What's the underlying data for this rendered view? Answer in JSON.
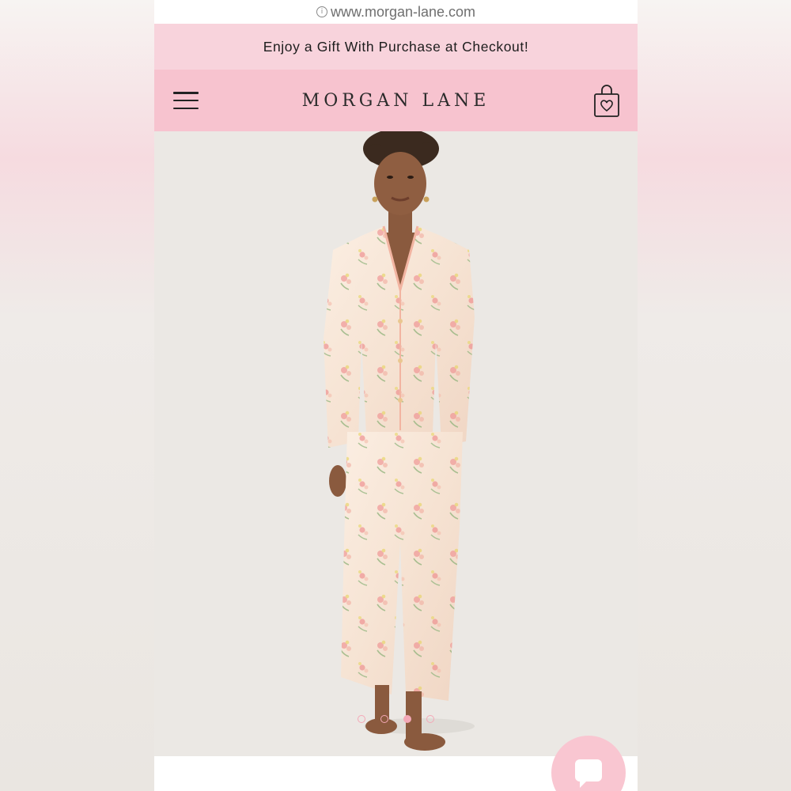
{
  "browser": {
    "url": "www.morgan-lane.com",
    "info_icon": "info-icon"
  },
  "promo": {
    "text": "Enjoy a Gift With Purchase at Checkout!"
  },
  "header": {
    "logo": "MORGAN LANE",
    "menu_icon": "hamburger-menu-icon",
    "bag_icon": "shopping-bag-heart-icon"
  },
  "hero": {
    "image": "model-in-floral-pajama-set",
    "slides_total": 4,
    "active_slide": 3
  },
  "chat": {
    "icon": "chat-bubble-icon"
  },
  "colors": {
    "promo_bg": "#f8d3dc",
    "header_bg": "#f7c3cf",
    "accent_pink": "#f4a8b7",
    "hero_bg": "#ebe8e4"
  }
}
